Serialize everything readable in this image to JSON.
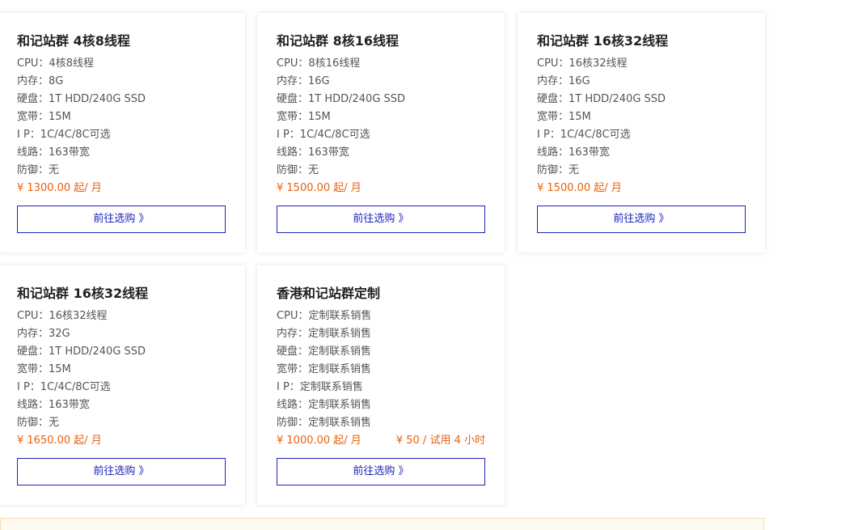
{
  "colors": {
    "accent_blue": "#1c25b8",
    "price_orange": "#e8610e",
    "title_text": "#222222",
    "spec_text": "#555555",
    "notice_bg": "#fffaf0",
    "notice_border": "#f6dcb4"
  },
  "cards": [
    {
      "title": "和记站群 4核8线程",
      "specs": [
        "CPU：4核8线程",
        "内存：8G",
        "硬盘：1T HDD/240G SSD",
        "宽带：15M",
        "I P：1C/4C/8C可选",
        "线路：163带宽",
        "防御：无"
      ],
      "price": "¥ 1300.00 起/ 月",
      "trial": "",
      "button": "前往选购 》"
    },
    {
      "title": "和记站群 8核16线程",
      "specs": [
        "CPU：8核16线程",
        "内存：16G",
        "硬盘：1T HDD/240G SSD",
        "宽带：15M",
        "I P：1C/4C/8C可选",
        "线路：163带宽",
        "防御：无"
      ],
      "price": "¥ 1500.00 起/ 月",
      "trial": "",
      "button": "前往选购 》"
    },
    {
      "title": "和记站群 16核32线程",
      "specs": [
        "CPU：16核32线程",
        "内存：16G",
        "硬盘：1T HDD/240G SSD",
        "宽带：15M",
        "I P：1C/4C/8C可选",
        "线路：163带宽",
        "防御：无"
      ],
      "price": "¥ 1500.00 起/ 月",
      "trial": "",
      "button": "前往选购 》"
    },
    {
      "title": "和记站群 16核32线程",
      "specs": [
        "CPU：16核32线程",
        "内存：32G",
        "硬盘：1T HDD/240G SSD",
        "宽带：15M",
        "I P：1C/4C/8C可选",
        "线路：163带宽",
        "防御：无"
      ],
      "price": "¥ 1650.00 起/ 月",
      "trial": "",
      "button": "前往选购 》"
    },
    {
      "title": "香港和记站群定制",
      "specs": [
        "CPU：定制联系销售",
        "内存：定制联系销售",
        "硬盘：定制联系销售",
        "宽带：定制联系销售",
        "I P：定制联系销售",
        "线路：定制联系销售",
        "防御：定制联系销售"
      ],
      "price": "¥ 1000.00 起/ 月",
      "trial": "¥ 50 / 试用 4 小时",
      "button": "前往选购 》"
    }
  ]
}
